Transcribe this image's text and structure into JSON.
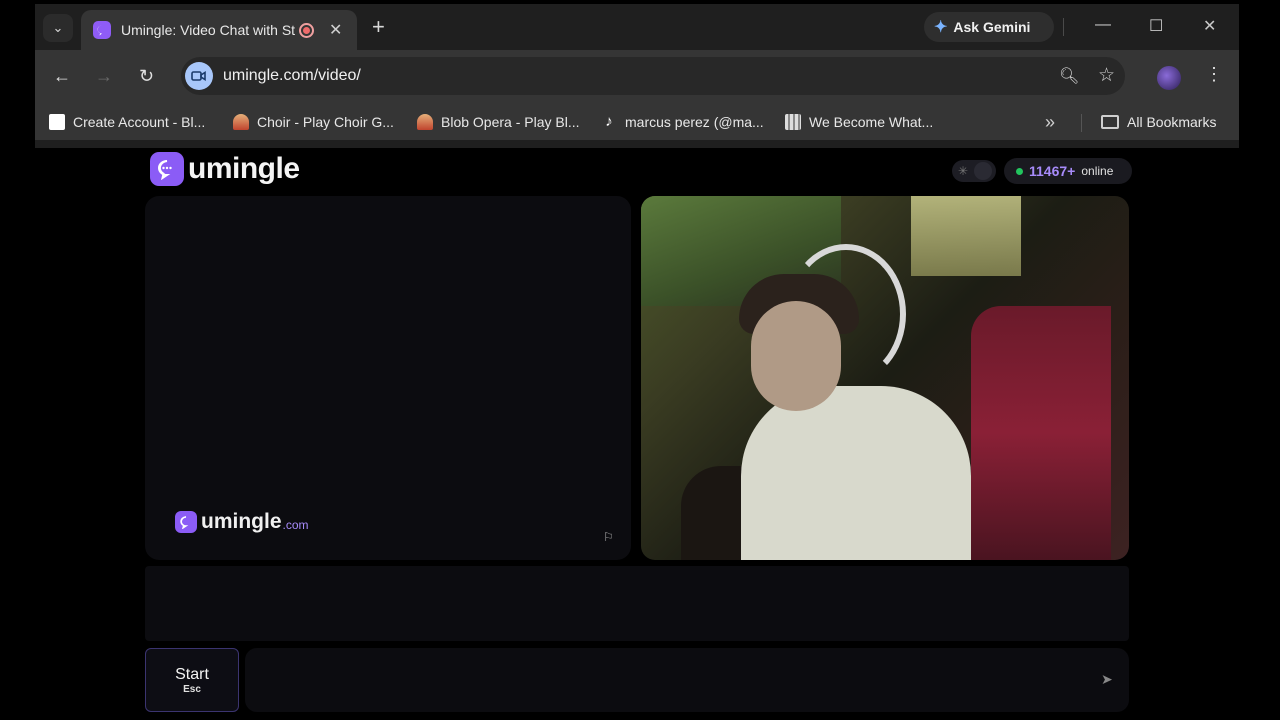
{
  "browser": {
    "tab": {
      "title": "Umingle: Video Chat with St",
      "favicon": "chat-bubble-icon",
      "recording": true
    },
    "gemini_label": "Ask Gemini",
    "url": "umingle.com/video/",
    "bookmarks": [
      {
        "label": "Create Account - Bl...",
        "icon": "tile-icon"
      },
      {
        "label": "Choir - Play Choir G...",
        "icon": "figure-icon"
      },
      {
        "label": "Blob Opera - Play Bl...",
        "icon": "figure-icon"
      },
      {
        "label": "marcus perez (@ma...",
        "icon": "tiktok-icon"
      },
      {
        "label": "We Become What...",
        "icon": "grid-icon"
      }
    ],
    "all_bookmarks_label": "All Bookmarks"
  },
  "site": {
    "logo_text": "umingle",
    "online_count": "11467+",
    "online_label": "online",
    "watermark_text": "umingle",
    "watermark_suffix": ".com",
    "start_label": "Start",
    "start_key": "Esc",
    "message_placeholder": "",
    "accent_color": "#8b5cf6",
    "online_dot_color": "#22c55e"
  }
}
